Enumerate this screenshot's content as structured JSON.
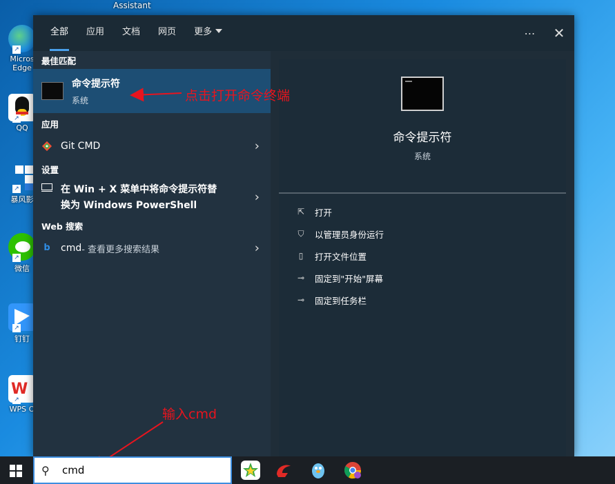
{
  "desktop": {
    "top_label": "Assistant",
    "icons": [
      {
        "label": "Micros Edge",
        "color": "#1f8fdf"
      },
      {
        "label": "QQ",
        "color": "#f5c518"
      },
      {
        "label": "暴风影",
        "color": "#2d7de0"
      },
      {
        "label": "微信",
        "color": "#2dc100"
      },
      {
        "label": "钉钉",
        "color": "#3296fa"
      },
      {
        "label": "WPS O",
        "color": "#e02a26"
      }
    ]
  },
  "tabs": [
    {
      "label": "全部",
      "active": true
    },
    {
      "label": "应用"
    },
    {
      "label": "文档"
    },
    {
      "label": "网页"
    },
    {
      "label": "更多"
    }
  ],
  "header": {
    "more_icon": "⋯",
    "close_icon": "✕"
  },
  "sections": {
    "best_match": "最佳匹配",
    "apps": "应用",
    "settings": "设置",
    "web_search": "Web 搜索"
  },
  "best_match": {
    "title": "命令提示符",
    "subtitle": "系统"
  },
  "apps": [
    {
      "label": "Git CMD",
      "icon": "git-icon"
    }
  ],
  "settings": [
    {
      "line1": "在 Win + X 菜单中将命令提示符替",
      "line2": "换为 Windows PowerShell",
      "icon": "monitor-icon"
    }
  ],
  "web": [
    {
      "query": "cmd",
      "suffix": " - 查看更多搜索结果",
      "icon": "bing-icon"
    }
  ],
  "preview": {
    "title": "命令提示符",
    "subtitle": "系统",
    "actions": [
      {
        "label": "打开",
        "icon": "open-icon"
      },
      {
        "label": "以管理员身份运行",
        "icon": "shield-icon"
      },
      {
        "label": "打开文件位置",
        "icon": "file-location-icon"
      },
      {
        "label": "固定到\"开始\"屏幕",
        "icon": "pin-icon"
      },
      {
        "label": "固定到任务栏",
        "icon": "pin-icon"
      }
    ]
  },
  "annotations": {
    "click_note": "点击打开命令终端",
    "input_note": "输入cmd"
  },
  "taskbar": {
    "search_value": "cmd"
  },
  "colors": {
    "accent": "#4aa0ec",
    "annotation": "#e8141e",
    "selected": "#1d4e74"
  }
}
